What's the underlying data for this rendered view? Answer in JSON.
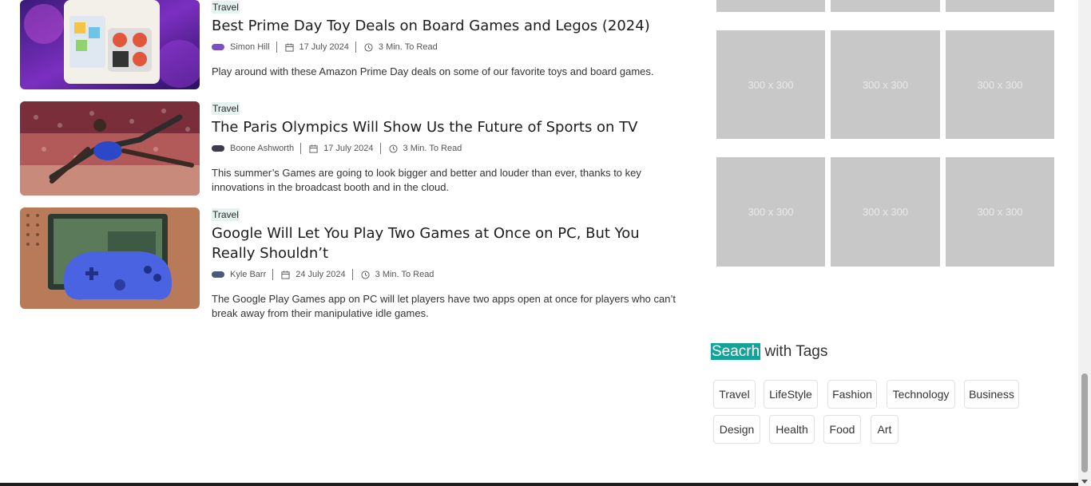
{
  "articles": [
    {
      "category": "Travel",
      "title": "Best Prime Day Toy Deals on Board Games and Legos (2024)",
      "author": "Simon Hill",
      "date": "17 July 2024",
      "read_time": "3 Min. To Read",
      "excerpt": "Play around with these Amazon Prime Day deals on some of our favorite toys and board games."
    },
    {
      "category": "Travel",
      "title": "The Paris Olympics Will Show Us the Future of Sports on TV",
      "author": "Boone Ashworth",
      "date": "17 July 2024",
      "read_time": "3 Min. To Read",
      "excerpt": "This summer’s Games are going to look bigger and better and louder than ever, thanks to key innovations in the broadcast booth and in the cloud."
    },
    {
      "category": "Travel",
      "title": "Google Will Let You Play Two Games at Once on PC, But You Really Shouldn’t",
      "author": "Kyle Barr",
      "date": "24 July 2024",
      "read_time": "3 Min. To Read",
      "excerpt": "The Google Play Games app on PC will let players have two apps open at once for players who can’t break away from their manipulative idle games."
    }
  ],
  "gallery": {
    "placeholder_label": "300 x 300"
  },
  "tags_widget": {
    "title_highlight": "Seacrh",
    "title_rest": " with Tags",
    "tags": [
      "Travel",
      "LifeStyle",
      "Fashion",
      "Technology",
      "Business",
      "Design",
      "Health",
      "Food",
      "Art"
    ]
  },
  "icons": {
    "date": "calendar-icon",
    "read_time": "clock-icon"
  },
  "colors": {
    "accent": "#14a39a",
    "category_bg": "#e4f2f0",
    "placeholder": "#c8c8c8"
  }
}
